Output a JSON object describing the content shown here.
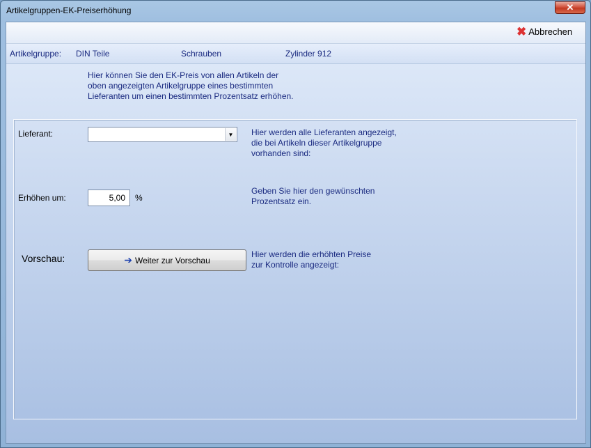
{
  "window": {
    "title": "Artikelgruppen-EK-Preiserhöhung",
    "close_glyph": "✕"
  },
  "toolbar": {
    "cancel_label": "Abbrechen",
    "cancel_icon": "close-x-icon"
  },
  "info": {
    "label": "Artikelgruppe:",
    "group1": "DIN Teile",
    "group2": "Schrauben",
    "group3": "Zylinder 912"
  },
  "intro": {
    "line1": "Hier können Sie den EK-Preis von allen Artikeln der",
    "line2": "oben angezeigten Artikelgruppe eines bestimmten",
    "line3": "Lieferanten um einen bestimmten Prozentsatz erhöhen."
  },
  "supplier": {
    "label": "Lieferant:",
    "value": "",
    "help1": "Hier werden alle Lieferanten angezeigt,",
    "help2": "die bei Artikeln dieser Artikelgruppe",
    "help3": "vorhanden sind:"
  },
  "increase": {
    "label": "Erhöhen um:",
    "value": "5,00",
    "unit": "%",
    "help1": "Geben Sie hier den gewünschten",
    "help2": "Prozentsatz ein."
  },
  "preview": {
    "label": "Vorschau:",
    "button_label": "Weiter zur Vorschau",
    "help1": "Hier werden die erhöhten Preise",
    "help2": "zur Kontrolle angezeigt:"
  }
}
